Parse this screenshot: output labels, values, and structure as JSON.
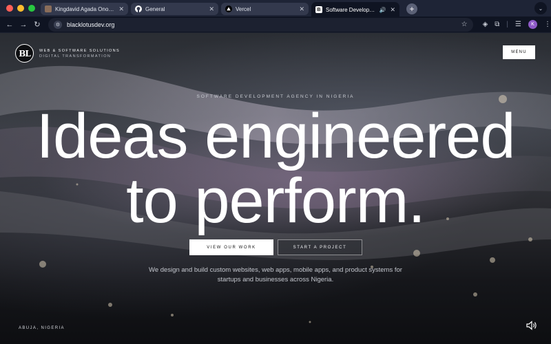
{
  "browser": {
    "tabs": [
      {
        "title": "Kingdavid Agada Onoja | Soft",
        "icon": "profile-photo-icon",
        "active": false
      },
      {
        "title": "General",
        "icon": "github-icon",
        "active": false
      },
      {
        "title": "Vercel",
        "icon": "vercel-icon",
        "active": false
      },
      {
        "title": "Software Development Ag",
        "icon": "site-icon",
        "active": true,
        "playing_audio": true
      }
    ],
    "url": "blacklotusdev.org",
    "profile_initial": "K",
    "colors": {
      "tabbar": "#1e2436",
      "toolbar": "#0f1422",
      "avatar": "#8e5ac8"
    }
  },
  "site": {
    "logo_text": "BL",
    "brand_line1": "WEB & SOFTWARE SOLUTIONS",
    "brand_line2": "DIGITAL TRANSFORMATION",
    "menu_label": "MENU",
    "eyebrow": "SOFTWARE DEVELOPMENT AGENCY IN NIGERIA",
    "headline_line1": "Ideas engineered",
    "headline_line2": "to perform.",
    "cta_primary": "VIEW OUR WORK",
    "cta_secondary": "START A PROJECT",
    "subtext_line1": "We design and build custom websites, web apps, mobile apps, and product systems for",
    "subtext_line2": "startups and businesses across Nigeria.",
    "location": "ABUJA, NIGERIA",
    "sound_icon": "speaker-icon"
  }
}
